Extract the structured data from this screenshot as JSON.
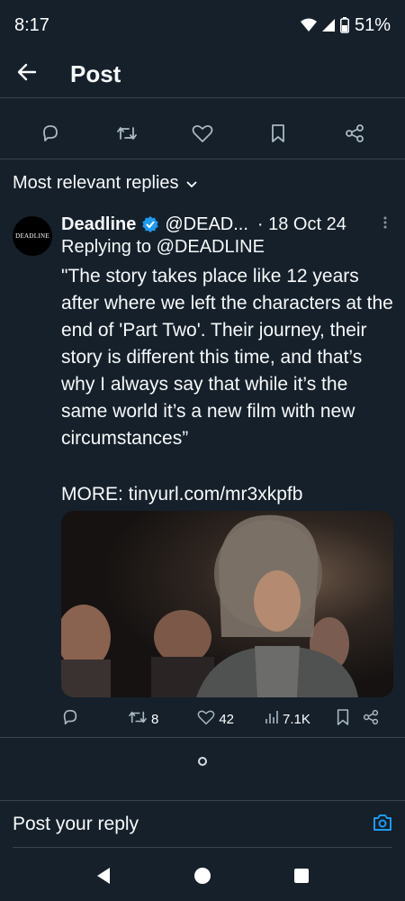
{
  "status": {
    "time": "8:17",
    "battery": "51%"
  },
  "header": {
    "title": "Post"
  },
  "sort": {
    "label": "Most relevant replies"
  },
  "reply": {
    "avatar_text": "DEADLINE",
    "author": "Deadline",
    "handle": "@DEAD...",
    "date": "· 18 Oct 24",
    "replying_to": "Replying to @DEADLINE",
    "text": "\"The story takes place like 12 years after where we left the characters at the end of 'Part Two'. Their journey, their story is different this time, and that’s why I always say that while it’s the same world it’s a new film with new circumstances”",
    "link_text": "MORE: tinyurl.com/mr3xkpfb",
    "retweets": "8",
    "likes": "42",
    "views": "7.1K"
  },
  "composer": {
    "placeholder": "Post your reply"
  },
  "colors": {
    "background": "#15202b",
    "accent": "#1d9bf0",
    "divider": "#38444d",
    "text": "#f7f9f9"
  },
  "icons": [
    "wifi-icon",
    "signal-icon",
    "battery-icon",
    "back-arrow-icon",
    "reply-icon",
    "retweet-icon",
    "like-icon",
    "bookmark-icon",
    "share-icon",
    "chevron-down-icon",
    "verified-icon",
    "more-icon",
    "views-icon",
    "camera-icon",
    "nav-back-icon",
    "nav-home-icon",
    "nav-recents-icon"
  ]
}
